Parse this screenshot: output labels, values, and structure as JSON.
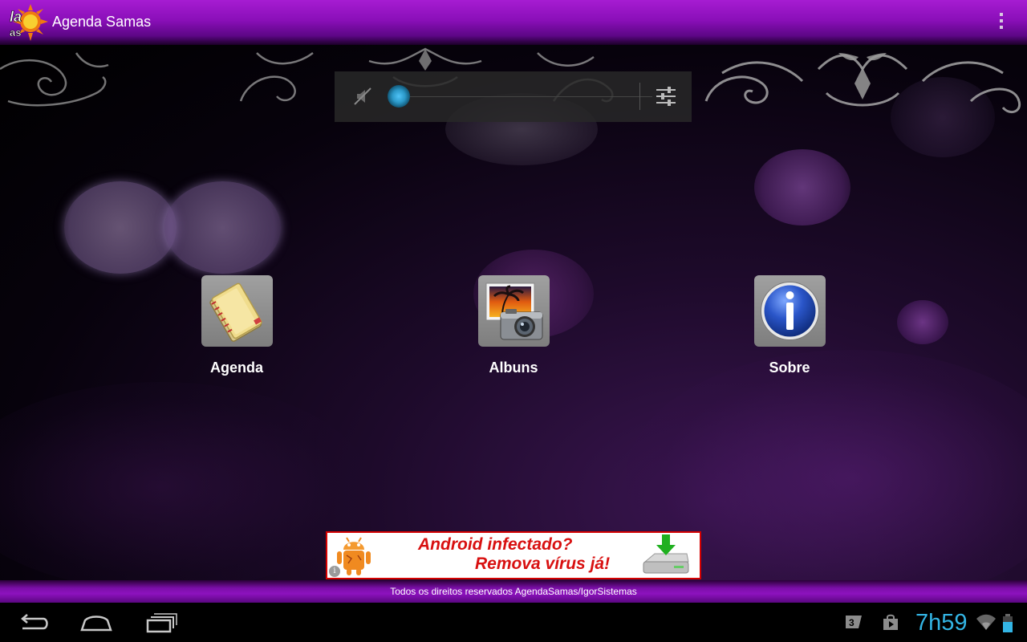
{
  "app": {
    "title": "Agenda Samas",
    "logo_text": "la\nas"
  },
  "launcher": {
    "items": [
      {
        "label": "Agenda",
        "icon": "address-book-icon"
      },
      {
        "label": "Albuns",
        "icon": "photo-camera-icon"
      },
      {
        "label": "Sobre",
        "icon": "info-icon"
      }
    ]
  },
  "ad": {
    "line1": "Android infectado?",
    "line2": "Remova vírus já!",
    "info_glyph": "i"
  },
  "footer": {
    "text": "Todos os direitos reservados AgendaSamas/IgorSistemas"
  },
  "status_bar": {
    "time": "7h59",
    "accent_color": "#33b5e5"
  },
  "volume": {
    "level": 0.0
  },
  "colors": {
    "titlebar": "#8a0fb8",
    "footer": "#8d12be",
    "ad_text": "#d81010"
  }
}
